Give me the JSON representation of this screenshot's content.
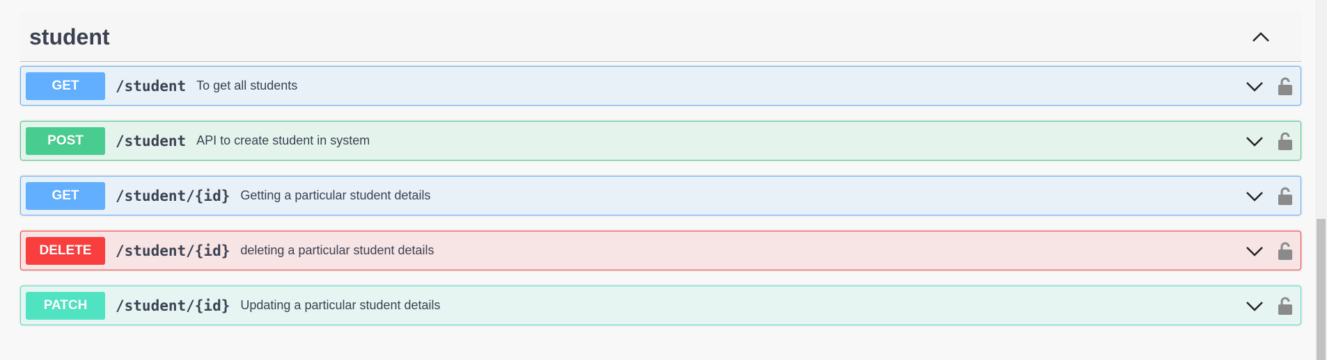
{
  "section": {
    "title": "student",
    "collapse_icon": "chevron-up-icon"
  },
  "operations": [
    {
      "method": "GET",
      "path": "/student",
      "summary": "To get all students",
      "color": "#61affe"
    },
    {
      "method": "POST",
      "path": "/student",
      "summary": "API to create student in system",
      "color": "#49cc90"
    },
    {
      "method": "GET",
      "path": "/student/{id}",
      "summary": "Getting a particular student details",
      "color": "#61affe"
    },
    {
      "method": "DELETE",
      "path": "/student/{id}",
      "summary": "deleting a particular student details",
      "color": "#f93e3e"
    },
    {
      "method": "PATCH",
      "path": "/student/{id}",
      "summary": "Updating a particular student details",
      "color": "#50e3c2"
    }
  ],
  "icons": {
    "expand": "chevron-down-icon",
    "auth": "unlock-icon"
  }
}
